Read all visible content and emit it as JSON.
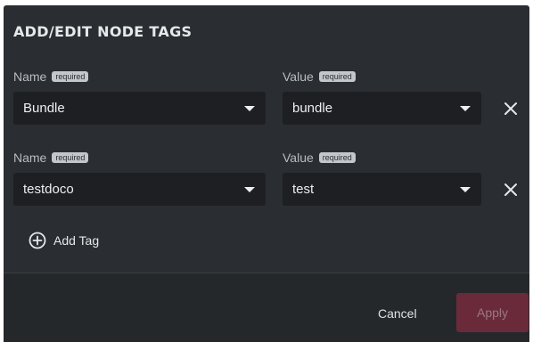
{
  "dialog": {
    "title": "ADD/EDIT NODE TAGS"
  },
  "tags": [
    {
      "name_label": "Name",
      "name_badge": "required",
      "name_value": "Bundle",
      "value_label": "Value",
      "value_badge": "required",
      "value_value": "bundle"
    },
    {
      "name_label": "Name",
      "name_badge": "required",
      "name_value": "testdoco",
      "value_label": "Value",
      "value_badge": "required",
      "value_value": "test"
    }
  ],
  "add_tag_label": "Add Tag",
  "footer": {
    "cancel_label": "Cancel",
    "apply_label": "Apply"
  },
  "colors": {
    "dialog_bg": "#2a2d31",
    "input_bg": "#1d1f22",
    "apply_bg": "#6a2a3a",
    "badge_bg": "#c3c7cc"
  },
  "icons": {
    "remove": "close-icon",
    "add": "plus-circle-icon",
    "dropdown": "caret-down-icon"
  }
}
